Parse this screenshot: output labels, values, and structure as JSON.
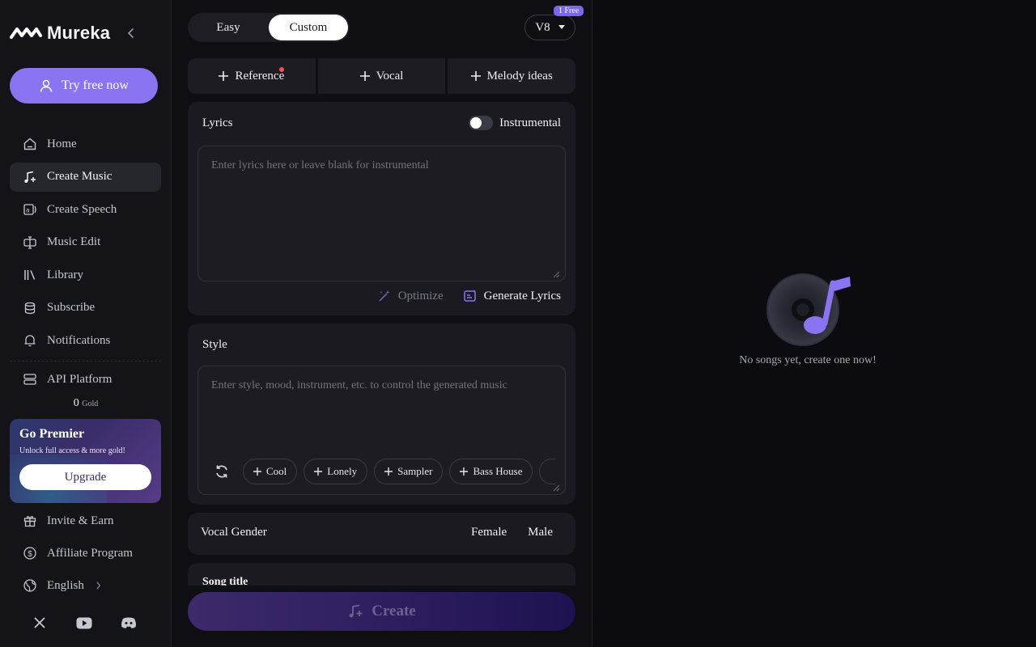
{
  "app": {
    "brand": "Mureka",
    "colors": {
      "accent": "#8a74f2",
      "bg": "#0d0d11",
      "panel": "#1a1a20"
    }
  },
  "sidebar": {
    "try_button": "Try free now",
    "items": [
      {
        "label": "Home",
        "icon": "home-icon"
      },
      {
        "label": "Create Music",
        "icon": "music-note-plus-icon",
        "active": true
      },
      {
        "label": "Create Speech",
        "icon": "speech-icon"
      },
      {
        "label": "Music Edit",
        "icon": "edit-cursor-icon"
      },
      {
        "label": "Library",
        "icon": "library-icon"
      },
      {
        "label": "Subscribe",
        "icon": "coins-icon"
      },
      {
        "label": "Notifications",
        "icon": "bell-icon"
      }
    ],
    "api_platform": "API Platform",
    "gold_amount": "0",
    "gold_unit": "Gold",
    "premier": {
      "title": "Go Premier",
      "subtitle": "Unlock full access & more gold!",
      "button": "Upgrade"
    },
    "bottom_items": [
      {
        "label": "Invite & Earn",
        "icon": "gift-icon"
      },
      {
        "label": "Affiliate Program",
        "icon": "dollar-circle-icon"
      },
      {
        "label": "English",
        "icon": "globe-icon"
      }
    ],
    "social": [
      "x-icon",
      "youtube-icon",
      "discord-icon"
    ]
  },
  "composer": {
    "modes": {
      "easy": "Easy",
      "custom": "Custom",
      "selected": "Custom"
    },
    "version": "V8",
    "version_badge": "1 Free",
    "reference_buttons": {
      "reference": "Reference",
      "vocal": "Vocal",
      "melody": "Melody ideas"
    },
    "lyrics": {
      "title": "Lyrics",
      "instrumental_label": "Instrumental",
      "instrumental_on": false,
      "placeholder": "Enter lyrics here or leave blank for instrumental",
      "optimize": "Optimize",
      "generate": "Generate Lyrics"
    },
    "style": {
      "title": "Style",
      "placeholder": "Enter style, mood, instrument, etc. to control the generated music",
      "tags": [
        "Cool",
        "Lonely",
        "Sampler",
        "Bass House"
      ]
    },
    "vocal_gender": {
      "title": "Vocal Gender",
      "female": "Female",
      "male": "Male"
    },
    "song_title": "Song title",
    "create_button": "Create"
  },
  "results": {
    "empty_text": "No songs yet, create one now!"
  }
}
